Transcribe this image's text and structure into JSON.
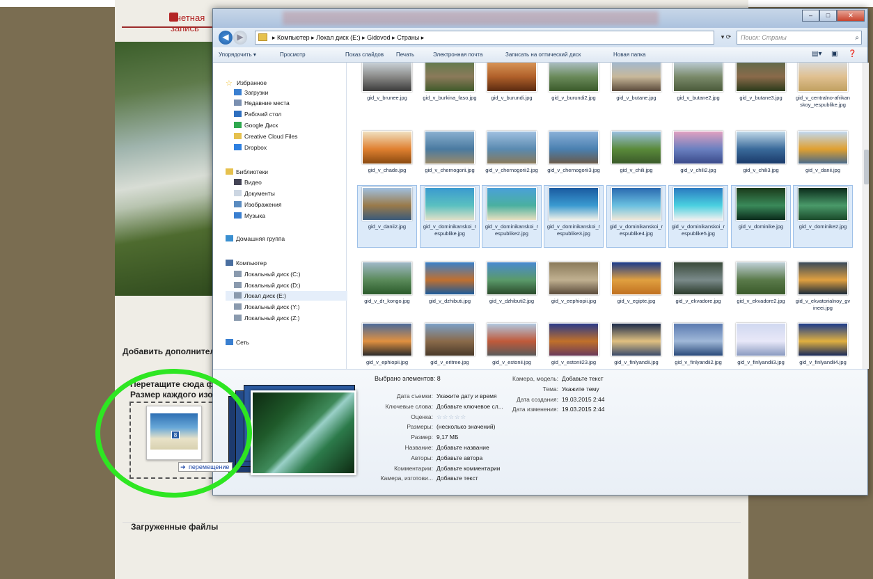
{
  "webpage": {
    "account_label": "Учетная запись",
    "add_label": "Добавить дополнительные изображения",
    "drop_text1": "Перетащите сюда файлы",
    "drop_text2": "Размер каждого изображения",
    "move_tooltip": "перемещение",
    "uploaded_label": "Загруженные файлы",
    "drag_count": "8",
    "highlight_color": "#2ee622"
  },
  "explorer": {
    "breadcrumb": "▸ Компьютер ▸ Локал диск (E:) ▸ Gidovod ▸ Страны ▸",
    "search_placeholder": "Поиск: Страны",
    "toolbar": {
      "organize": "Упорядочить ▾",
      "view": "Просмотр",
      "slideshow": "Показ слайдов",
      "print": "Печать",
      "email": "Электронная почта",
      "burn": "Записать на оптический диск",
      "new_folder": "Новая папка"
    },
    "nav": [
      {
        "label": "Избранное",
        "icon": "star-icon",
        "color": "#f0c030"
      },
      {
        "label": "Загрузки",
        "icon": "downloads-icon",
        "color": "#3a7fd0"
      },
      {
        "label": "Недавние места",
        "icon": "recent-places-icon",
        "color": "#7a8fb0"
      },
      {
        "label": "Рабочий стол",
        "icon": "desktop-icon",
        "color": "#2e6fbf"
      },
      {
        "label": "Google Диск",
        "icon": "google-drive-icon",
        "color": "#2fa84f"
      },
      {
        "label": "Creative Cloud Files",
        "icon": "folder-icon",
        "color": "#e6c14e"
      },
      {
        "label": "Dropbox",
        "icon": "dropbox-icon",
        "color": "#2d7fe0"
      },
      {
        "label": "Библиотеки",
        "icon": "libraries-icon",
        "color": "#e6c14e"
      },
      {
        "label": "Видео",
        "icon": "video-icon",
        "color": "#445"
      },
      {
        "label": "Документы",
        "icon": "documents-icon",
        "color": "#ccd6e2"
      },
      {
        "label": "Изображения",
        "icon": "pictures-icon",
        "color": "#5a8bc0"
      },
      {
        "label": "Музыка",
        "icon": "music-icon",
        "color": "#3a7fd0"
      },
      {
        "label": "Домашняя группа",
        "icon": "homegroup-icon",
        "color": "#3a8fd0"
      },
      {
        "label": "Компьютер",
        "icon": "computer-icon",
        "color": "#4a6fa0"
      },
      {
        "label": "Локальный диск (C:)",
        "icon": "drive-icon",
        "color": "#8a9aae"
      },
      {
        "label": "Локальный диск (D:)",
        "icon": "drive-icon",
        "color": "#8a9aae"
      },
      {
        "label": "Локал диск (E:)",
        "icon": "drive-icon",
        "color": "#8a9aae"
      },
      {
        "label": "Локальный диск (Y:)",
        "icon": "network-drive-icon",
        "color": "#8a9aae"
      },
      {
        "label": "Локальный диск (Z:)",
        "icon": "network-drive-icon",
        "color": "#8a9aae"
      },
      {
        "label": "Сеть",
        "icon": "network-icon",
        "color": "#3a7fd0"
      }
    ],
    "files": [
      {
        "name": "gid_v_brunee.jpg",
        "selected": false,
        "c": [
          "#d8e2ea",
          "#8a8a88",
          "#3a3a3a"
        ]
      },
      {
        "name": "gid_v_burkina_faso.jpg",
        "selected": false,
        "c": [
          "#5b7a4a",
          "#8b7a5a",
          "#3f5a2a"
        ]
      },
      {
        "name": "gid_v_burundi.jpg",
        "selected": false,
        "c": [
          "#e0a060",
          "#b0602a",
          "#5a2a10"
        ]
      },
      {
        "name": "gid_v_burundi2.jpg",
        "selected": false,
        "c": [
          "#b9c9d8",
          "#6a8a5a",
          "#3a5a2a"
        ]
      },
      {
        "name": "gid_v_butane.jpg",
        "selected": false,
        "c": [
          "#9ab8d8",
          "#c8b89a",
          "#5a4a3a"
        ]
      },
      {
        "name": "gid_v_butane2.jpg",
        "selected": false,
        "c": [
          "#c8d8e8",
          "#7a8a6a",
          "#4a5a3a"
        ]
      },
      {
        "name": "gid_v_butane3.jpg",
        "selected": false,
        "c": [
          "#5a6a4a",
          "#8a6a4a",
          "#2a3a1a"
        ]
      },
      {
        "name": "gid_v_centralno-afrikanskoy_respublike.jpg",
        "selected": false,
        "c": [
          "#d8e0e8",
          "#e0c090",
          "#c0a060"
        ]
      },
      {
        "name": "gid_v_chade.jpg",
        "selected": false,
        "c": [
          "#f0e0c0",
          "#e08030",
          "#8a4a10"
        ]
      },
      {
        "name": "gid_v_chernogorii.jpg",
        "selected": false,
        "c": [
          "#8ab0d0",
          "#4a7aa0",
          "#9a8a6a"
        ]
      },
      {
        "name": "gid_v_chernogorii2.jpg",
        "selected": false,
        "c": [
          "#a0c0e0",
          "#5a8ab0",
          "#8a7a5a"
        ]
      },
      {
        "name": "gid_v_chernogorii3.jpg",
        "selected": false,
        "c": [
          "#8ab0d8",
          "#4a80b0",
          "#6a5a4a"
        ]
      },
      {
        "name": "gid_v_chili.jpg",
        "selected": false,
        "c": [
          "#9ac0e0",
          "#5a8a3a",
          "#3a5a2a"
        ]
      },
      {
        "name": "gid_v_chili2.jpg",
        "selected": false,
        "c": [
          "#e0a0c0",
          "#6a80c0",
          "#3a4a8a"
        ]
      },
      {
        "name": "gid_v_chili3.jpg",
        "selected": false,
        "c": [
          "#c0d8e8",
          "#3a6a9a",
          "#1a3a6a"
        ]
      },
      {
        "name": "gid_v_danii.jpg",
        "selected": false,
        "c": [
          "#c0d8f0",
          "#e0a030",
          "#4a6a8a"
        ]
      },
      {
        "name": "gid_v_danii2.jpg",
        "selected": true,
        "c": [
          "#a0c0e0",
          "#9a7a4a",
          "#3a5a7a"
        ]
      },
      {
        "name": "gid_v_dominikanskoi_respublike.jpg",
        "selected": true,
        "c": [
          "#3a9ad0",
          "#5ac0c0",
          "#e0e0c8"
        ]
      },
      {
        "name": "gid_v_dominikanskoi_respublike2.jpg",
        "selected": true,
        "c": [
          "#4aa0d8",
          "#4ab0a0",
          "#e8e0c0"
        ]
      },
      {
        "name": "gid_v_dominikanskoi_respublike3.jpg",
        "selected": true,
        "c": [
          "#1a5aa0",
          "#3a9ad0",
          "#f0f0e8"
        ]
      },
      {
        "name": "gid_v_dominikanskoi_respublike4.jpg",
        "selected": true,
        "c": [
          "#2a6ab0",
          "#6ac0e0",
          "#f0e8d8"
        ]
      },
      {
        "name": "gid_v_dominikanskoi_respublike5.jpg",
        "selected": true,
        "c": [
          "#2a7ac0",
          "#4ad0e0",
          "#f0f0f0"
        ]
      },
      {
        "name": "gid_v_dominike.jpg",
        "selected": true,
        "c": [
          "#1a3a1a",
          "#3a8a5a",
          "#0a2a1a"
        ]
      },
      {
        "name": "gid_v_dominike2.jpg",
        "selected": true,
        "c": [
          "#0a2a1a",
          "#4a9a6a",
          "#1a4a2a"
        ]
      },
      {
        "name": "gid_v_dr_kongo.jpg",
        "selected": false,
        "c": [
          "#a0b8c8",
          "#5a8a5a",
          "#2a5a2a"
        ]
      },
      {
        "name": "gid_v_dzhibuti.jpg",
        "selected": false,
        "c": [
          "#3a80c8",
          "#c07030",
          "#1a5a9a"
        ]
      },
      {
        "name": "gid_v_dzhibuti2.jpg",
        "selected": false,
        "c": [
          "#4a8ad0",
          "#5a9a6a",
          "#2a4a2a"
        ]
      },
      {
        "name": "gid_v_eephiopii.jpg",
        "selected": false,
        "c": [
          "#8a7a5a",
          "#c0b090",
          "#5a4a3a"
        ]
      },
      {
        "name": "gid_v_egipte.jpg",
        "selected": false,
        "c": [
          "#1a3a8a",
          "#e0a040",
          "#c07020"
        ]
      },
      {
        "name": "gid_v_ekvadore.jpg",
        "selected": false,
        "c": [
          "#3a4a3a",
          "#7a8a8a",
          "#2a3a2a"
        ]
      },
      {
        "name": "gid_v_ekvadore2.jpg",
        "selected": false,
        "c": [
          "#c0d0d8",
          "#5a7a4a",
          "#3a5a2a"
        ]
      },
      {
        "name": "gid_v_ekvatorialnoy_gvineei.jpg",
        "selected": false,
        "c": [
          "#3a4a5a",
          "#e0a040",
          "#1a2a3a"
        ]
      },
      {
        "name": "gid_v_ephiopii.jpg",
        "selected": false,
        "c": [
          "#4a6a9a",
          "#e09040",
          "#2a2a2a"
        ]
      },
      {
        "name": "gid_v_eritree.jpg",
        "selected": false,
        "c": [
          "#7aa0c8",
          "#8a6a4a",
          "#4a3a2a"
        ]
      },
      {
        "name": "gid_v_estonii.jpg",
        "selected": false,
        "c": [
          "#b0c8e0",
          "#c05a3a",
          "#5a5a5a"
        ]
      },
      {
        "name": "gid_v_estonii23.jpg",
        "selected": false,
        "c": [
          "#2a3a8a",
          "#c0702a",
          "#6a3a5a"
        ]
      },
      {
        "name": "gid_v_finlyandii.jpg",
        "selected": false,
        "c": [
          "#1a2a4a",
          "#e0c080",
          "#3a4a6a"
        ]
      },
      {
        "name": "gid_v_finlyandii2.jpg",
        "selected": false,
        "c": [
          "#5a7ab0",
          "#a0b8d8",
          "#2a4a7a"
        ]
      },
      {
        "name": "gid_v_finlyandii3.jpg",
        "selected": false,
        "c": [
          "#d0d8f0",
          "#e8e8f8",
          "#8a9ac0"
        ]
      },
      {
        "name": "gid_v_finlyandii4.jpg",
        "selected": false,
        "c": [
          "#1a3a8a",
          "#e0b040",
          "#1a2a5a"
        ]
      }
    ],
    "details": {
      "selected": "Выбрано элементов: 8",
      "rows": [
        {
          "label": "Дата съемки:",
          "value": "Укажите дату и время"
        },
        {
          "label": "Ключевые слова:",
          "value": "Добавьте ключевое сл..."
        },
        {
          "label": "Оценка:",
          "value": "☆☆☆☆☆"
        },
        {
          "label": "Размеры:",
          "value": "(несколько значений)"
        },
        {
          "label": "Размер:",
          "value": "9,17 МБ"
        },
        {
          "label": "Название:",
          "value": "Добавьте название"
        },
        {
          "label": "Авторы:",
          "value": "Добавьте автора"
        },
        {
          "label": "Комментарии:",
          "value": "Добавьте комментарии"
        },
        {
          "label": "Камера, изготови...",
          "value": "Добавьте текст"
        }
      ],
      "right_rows": [
        {
          "label": "Камера, модель:",
          "value": "Добавьте текст"
        },
        {
          "label": "Тема:",
          "value": "Укажите тему"
        },
        {
          "label": "Дата создания:",
          "value": "19.03.2015 2:44"
        },
        {
          "label": "Дата изменения:",
          "value": "19.03.2015 2:44"
        }
      ]
    }
  }
}
